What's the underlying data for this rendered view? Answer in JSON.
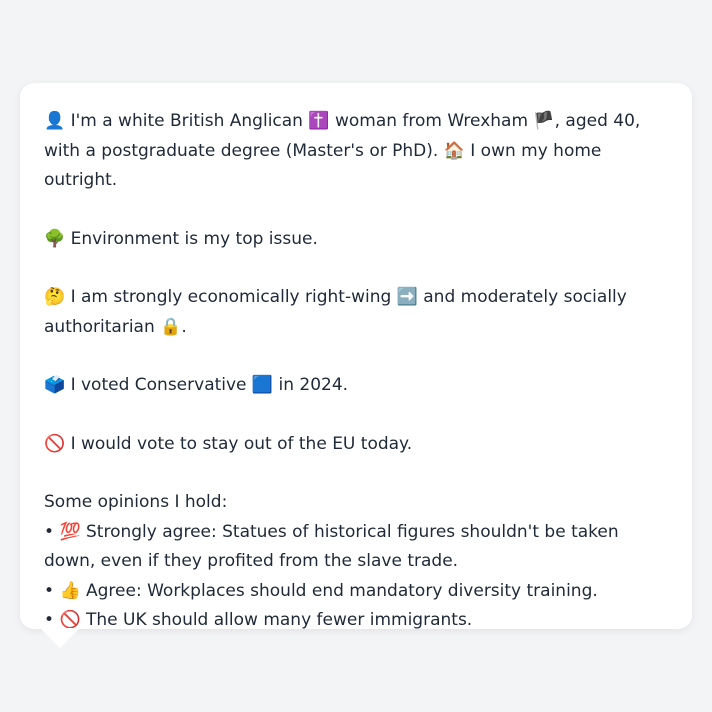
{
  "profile": {
    "intro": {
      "icon_person": "👤",
      "text1": "I'm a white British Anglican",
      "icon_cross": "✝️",
      "text2": "woman from Wrexham",
      "icon_flag": "🏴",
      "text3": ", aged 40, with a postgraduate degree (Master's or PhD).",
      "icon_house": "🏠",
      "text4": "I own my home outright."
    },
    "environment": {
      "icon": "🌳",
      "text": "Environment is my top issue."
    },
    "ideology": {
      "icon": "🤔",
      "text1": "I am strongly economically right-wing",
      "icon_arrow": "➡️",
      "text2": "and moderately socially authoritarian",
      "icon_lock": "🔒",
      "text3": "."
    },
    "vote": {
      "icon": "🗳️",
      "text1": "I voted Conservative",
      "icon_square": "🟦",
      "text2": "in 2024."
    },
    "eu": {
      "icon": "🚫",
      "text": "I would vote to stay out of the EU today."
    },
    "opinions": {
      "heading": "Some opinions I hold:",
      "bullet": "•",
      "items": [
        {
          "icon": "💯",
          "text": "Strongly agree: Statues of historical figures shouldn't be taken down, even if they profited from the slave trade."
        },
        {
          "icon": "👍",
          "text": "Agree: Workplaces should end mandatory diversity training."
        },
        {
          "icon": "🚫",
          "text": "The UK should allow many fewer immigrants."
        }
      ]
    }
  }
}
